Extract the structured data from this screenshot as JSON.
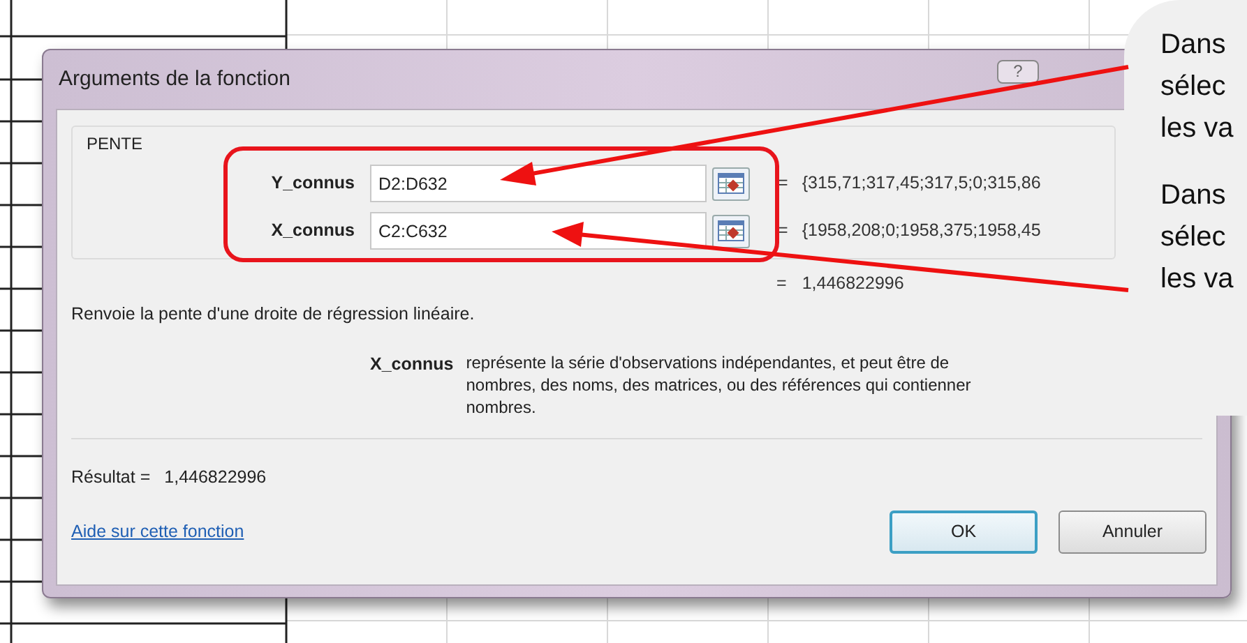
{
  "window": {
    "title": "Arguments de la fonction",
    "help_button": "?"
  },
  "function": {
    "name": "PENTE",
    "arguments": [
      {
        "label": "Y_connus",
        "value": "D2:D632",
        "equals": "=",
        "preview": "{315,71;317,45;317,5;0;315,86"
      },
      {
        "label": "X_connus",
        "value": "C2:C632",
        "equals": "=",
        "preview": "{1958,208;0;1958,375;1958,45"
      }
    ],
    "result_preview": {
      "equals": "=",
      "value": "1,446822996"
    }
  },
  "description": "Renvoie la pente d'une droite de régression linéaire.",
  "argument_help": {
    "name": "X_connus",
    "text": "représente la série d'observations indépendantes, et peut être de\nnombres, des noms, des matrices, ou des références qui contienner\nnombres."
  },
  "result": {
    "label": "Résultat =",
    "value": "1,446822996"
  },
  "help_link": "Aide sur cette fonction",
  "buttons": [
    {
      "label": "OK",
      "default": true
    },
    {
      "label": "Annuler",
      "default": false
    }
  ],
  "callout": {
    "paragraphs": [
      "Dans\nsélec\nles va",
      "Dans\nsélec\nles va"
    ]
  }
}
